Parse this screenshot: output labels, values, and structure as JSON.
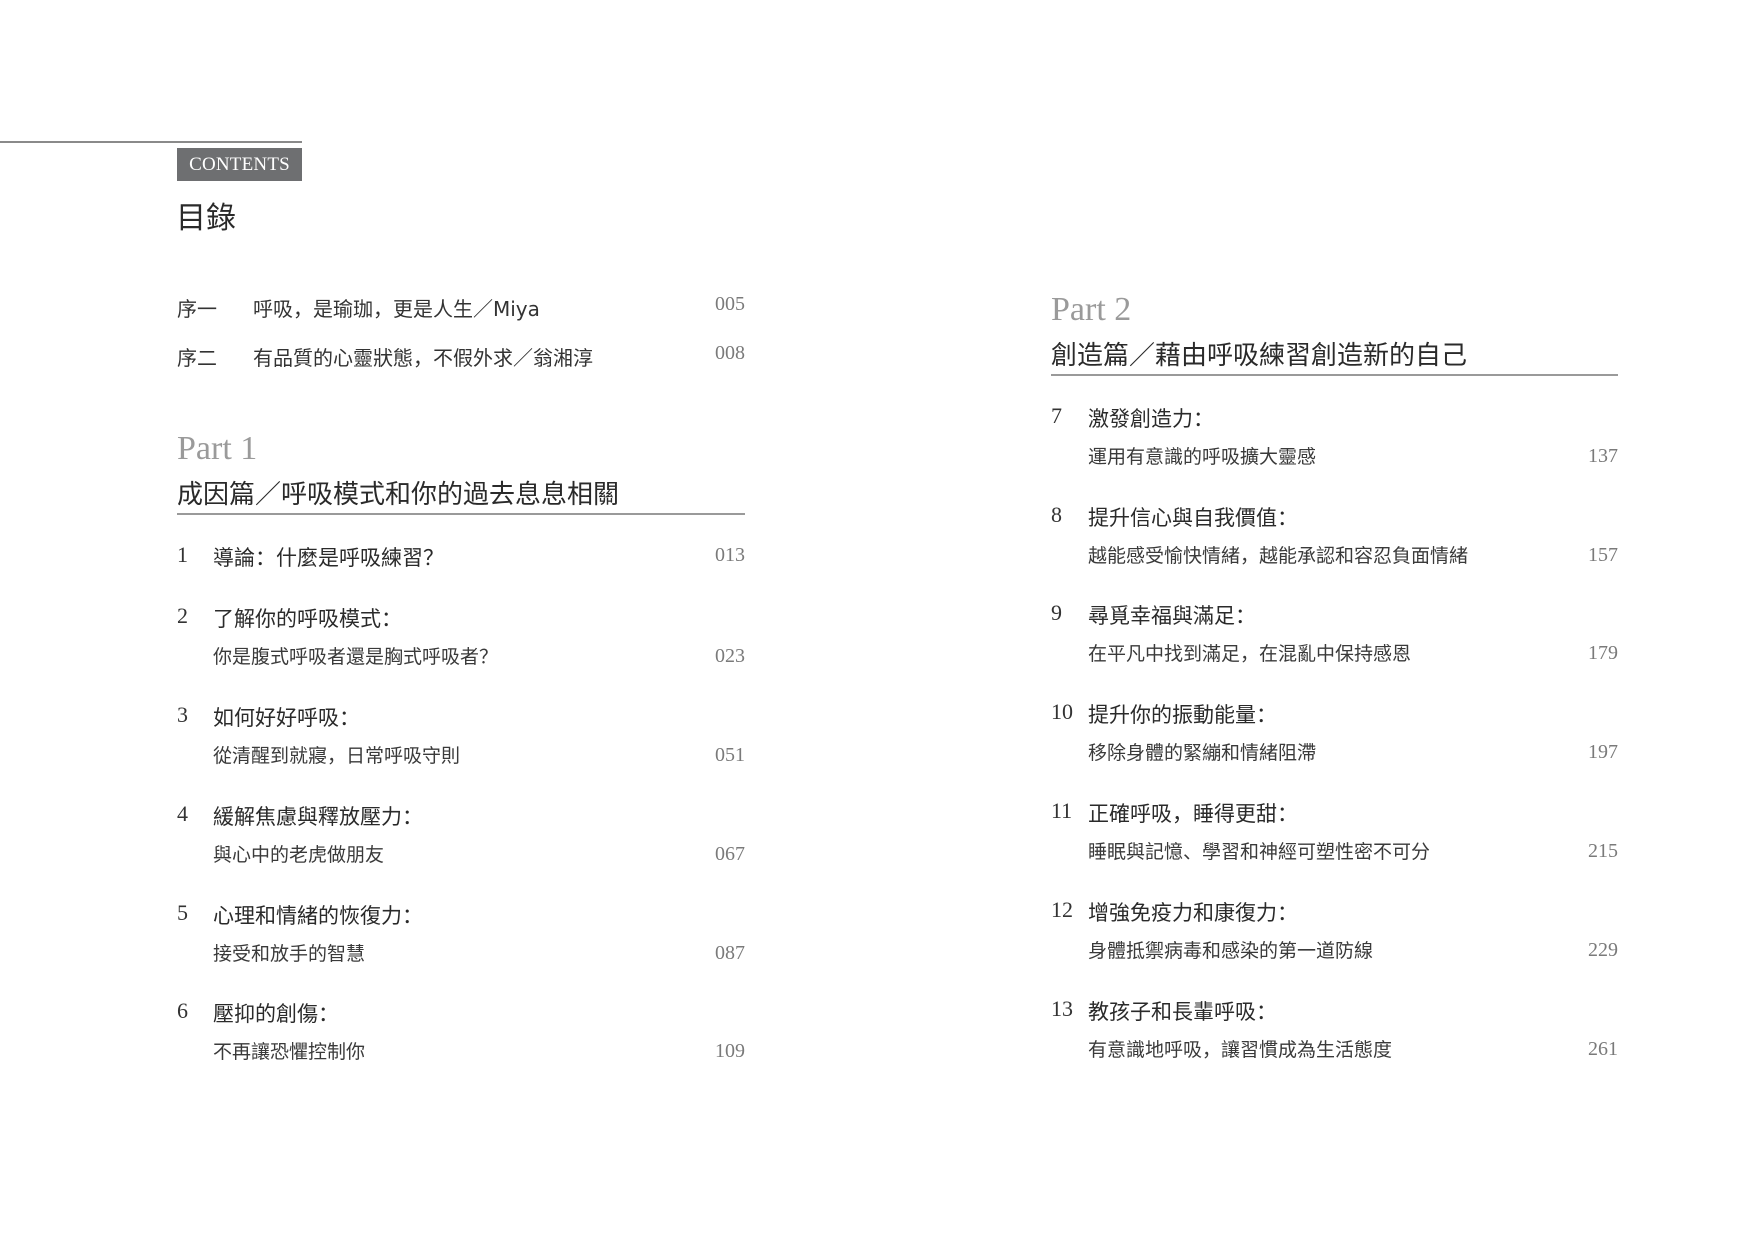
{
  "header": {
    "badge": "CONTENTS",
    "title": "目錄"
  },
  "prefaces": [
    {
      "label": "序一",
      "text": "呼吸，是瑜珈，更是人生／Miya",
      "page": "005"
    },
    {
      "label": "序二",
      "text": "有品質的心靈狀態，不假外求／翁湘淳",
      "page": "008"
    }
  ],
  "parts": [
    {
      "label": "Part 1",
      "title": "成因篇／呼吸模式和你的過去息息相關",
      "chapters": [
        {
          "num": "1",
          "title": "導論：什麼是呼吸練習？",
          "subtitle": "",
          "page": "013"
        },
        {
          "num": "2",
          "title": "了解你的呼吸模式：",
          "subtitle": "你是腹式呼吸者還是胸式呼吸者？",
          "page": "023"
        },
        {
          "num": "3",
          "title": "如何好好呼吸：",
          "subtitle": "從清醒到就寢，日常呼吸守則",
          "page": "051"
        },
        {
          "num": "4",
          "title": "緩解焦慮與釋放壓力：",
          "subtitle": "與心中的老虎做朋友",
          "page": "067"
        },
        {
          "num": "5",
          "title": "心理和情緒的恢復力：",
          "subtitle": "接受和放手的智慧",
          "page": "087"
        },
        {
          "num": "6",
          "title": "壓抑的創傷：",
          "subtitle": "不再讓恐懼控制你",
          "page": "109"
        }
      ]
    },
    {
      "label": "Part 2",
      "title": "創造篇／藉由呼吸練習創造新的自己",
      "chapters": [
        {
          "num": "7",
          "title": "激發創造力：",
          "subtitle": "運用有意識的呼吸擴大靈感",
          "page": "137"
        },
        {
          "num": "8",
          "title": "提升信心與自我價值：",
          "subtitle": "越能感受愉快情緒，越能承認和容忍負面情緒",
          "page": "157"
        },
        {
          "num": "9",
          "title": "尋覓幸福與滿足：",
          "subtitle": "在平凡中找到滿足，在混亂中保持感恩",
          "page": "179"
        },
        {
          "num": "10",
          "title": "提升你的振動能量：",
          "subtitle": "移除身體的緊繃和情緒阻滯",
          "page": "197"
        },
        {
          "num": "11",
          "title": "正確呼吸，睡得更甜：",
          "subtitle": "睡眠與記憶、學習和神經可塑性密不可分",
          "page": "215"
        },
        {
          "num": "12",
          "title": "增強免疫力和康復力：",
          "subtitle": "身體抵禦病毒和感染的第一道防線",
          "page": "229"
        },
        {
          "num": "13",
          "title": "教孩子和長輩呼吸：",
          "subtitle": "有意識地呼吸，讓習慣成為生活態度",
          "page": "261"
        }
      ]
    }
  ]
}
